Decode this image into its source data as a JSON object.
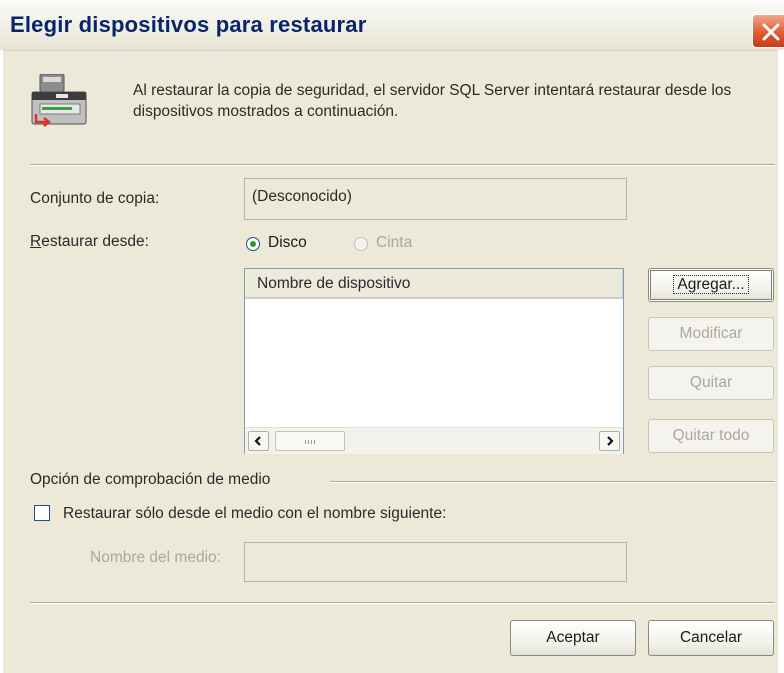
{
  "window": {
    "title": "Elegir dispositivos para restaurar"
  },
  "header": {
    "icon": "database-restore-icon",
    "description": "Al restaurar la copia de seguridad, el servidor SQL Server intentará restaurar desde los dispositivos mostrados a continuación."
  },
  "backup_set": {
    "label": "Conjunto de copia:",
    "value": "(Desconocido)"
  },
  "restore_from": {
    "label": "Restaurar desde:",
    "options": [
      {
        "label": "Disco",
        "selected": true,
        "enabled": true
      },
      {
        "label": "Cinta",
        "selected": false,
        "enabled": false
      }
    ]
  },
  "device_list": {
    "column_header": "Nombre de dispositivo",
    "rows": []
  },
  "side_buttons": {
    "add": "Agregar...",
    "modify": "Modificar",
    "remove": "Quitar",
    "remove_all": "Quitar todo"
  },
  "media_check": {
    "group_label": "Opción de comprobación de medio",
    "checkbox_label": "Restaurar sólo desde el medio con el nombre siguiente:",
    "checkbox_checked": false,
    "media_name_label": "Nombre del medio:",
    "media_name_value": ""
  },
  "footer": {
    "ok": "Aceptar",
    "cancel": "Cancelar"
  },
  "colors": {
    "title_text": "#0a246a",
    "dialog_background": "#ece9d8",
    "close_button": "#e0562f",
    "radio_selected_dot": "#21a121"
  }
}
